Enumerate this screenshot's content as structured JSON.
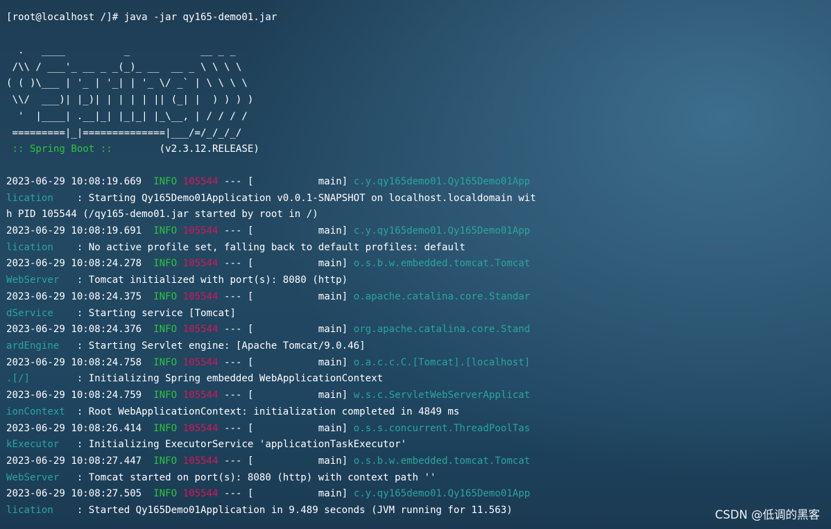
{
  "command": "[root@localhost /]# java -jar qy165-demo01.jar",
  "banner": [
    "  .   ____          _            __ _ _",
    " /\\\\ / ___'_ __ _ _(_)_ __  __ _ \\ \\ \\ \\",
    "( ( )\\___ | '_ | '_| | '_ \\/ _` | \\ \\ \\ \\",
    " \\\\/  ___)| |_)| | | | | || (_| |  ) ) ) )",
    "  '  |____| .__|_| |_|_| |_\\__, | / / / /",
    " =========|_|==============|___/=/_/_/_/"
  ],
  "spring": {
    "label": " :: Spring Boot :: ",
    "version": "       (v2.3.12.RELEASE)"
  },
  "log_lines": [
    {
      "timestamp": "2023-06-29 10:08:19.669",
      "level": "INFO",
      "pid": "105544",
      "sep": " --- [           main] ",
      "logger_a": "c.y.qy165demo01.Qy165Demo01App",
      "logger_b": "lication",
      "msg_a": "    : Starting Qy165Demo01Application v0.0.1-SNAPSHOT on localhost.localdomain wit",
      "msg_b": "h PID 105544 (/qy165-demo01.jar started by root in /)"
    },
    {
      "timestamp": "2023-06-29 10:08:19.691",
      "level": "INFO",
      "pid": "105544",
      "sep": " --- [           main] ",
      "logger_a": "c.y.qy165demo01.Qy165Demo01App",
      "logger_b": "lication",
      "msg_a": "    : No active profile set, falling back to default profiles: default"
    },
    {
      "timestamp": "2023-06-29 10:08:24.278",
      "level": "INFO",
      "pid": "105544",
      "sep": " --- [           main] ",
      "logger_a": "o.s.b.w.embedded.tomcat.Tomcat",
      "logger_b": "WebServer",
      "msg_a": "   : Tomcat initialized with port(s): 8080 (http)"
    },
    {
      "timestamp": "2023-06-29 10:08:24.375",
      "level": "INFO",
      "pid": "105544",
      "sep": " --- [           main] ",
      "logger_a": "o.apache.catalina.core.Standar",
      "logger_b": "dService",
      "msg_a": "    : Starting service [Tomcat]"
    },
    {
      "timestamp": "2023-06-29 10:08:24.376",
      "level": "INFO",
      "pid": "105544",
      "sep": " --- [           main] ",
      "logger_a": "org.apache.catalina.core.Stand",
      "logger_b": "ardEngine",
      "msg_a": "   : Starting Servlet engine: [Apache Tomcat/9.0.46]"
    },
    {
      "timestamp": "2023-06-29 10:08:24.758",
      "level": "INFO",
      "pid": "105544",
      "sep": " --- [           main] ",
      "logger_a": "o.a.c.c.C.[Tomcat].[localhost]",
      "logger_b": ".[/]",
      "msg_a": "        : Initializing Spring embedded WebApplicationContext"
    },
    {
      "timestamp": "2023-06-29 10:08:24.759",
      "level": "INFO",
      "pid": "105544",
      "sep": " --- [           main] ",
      "logger_a": "w.s.c.ServletWebServerApplicat",
      "logger_b": "ionContext",
      "msg_a": "  : Root WebApplicationContext: initialization completed in 4849 ms"
    },
    {
      "timestamp": "2023-06-29 10:08:26.414",
      "level": "INFO",
      "pid": "105544",
      "sep": " --- [           main] ",
      "logger_a": "o.s.s.concurrent.ThreadPoolTas",
      "logger_b": "kExecutor",
      "msg_a": "   : Initializing ExecutorService 'applicationTaskExecutor'"
    },
    {
      "timestamp": "2023-06-29 10:08:27.447",
      "level": "INFO",
      "pid": "105544",
      "sep": " --- [           main] ",
      "logger_a": "o.s.b.w.embedded.tomcat.Tomcat",
      "logger_b": "WebServer",
      "msg_a": "   : Tomcat started on port(s): 8080 (http) with context path ''"
    },
    {
      "timestamp": "2023-06-29 10:08:27.505",
      "level": "INFO",
      "pid": "105544",
      "sep": " --- [           main] ",
      "logger_a": "c.y.qy165demo01.Qy165Demo01App",
      "logger_b": "lication",
      "msg_a": "    : Started Qy165Demo01Application in 9.489 seconds (JVM running for 11.563)"
    }
  ],
  "watermark": "CSDN @低调的黑客",
  "colors": {
    "info": "#2ec33f",
    "pid": "#d8155a",
    "logger": "#2aa59b",
    "text": "#ffffff"
  }
}
